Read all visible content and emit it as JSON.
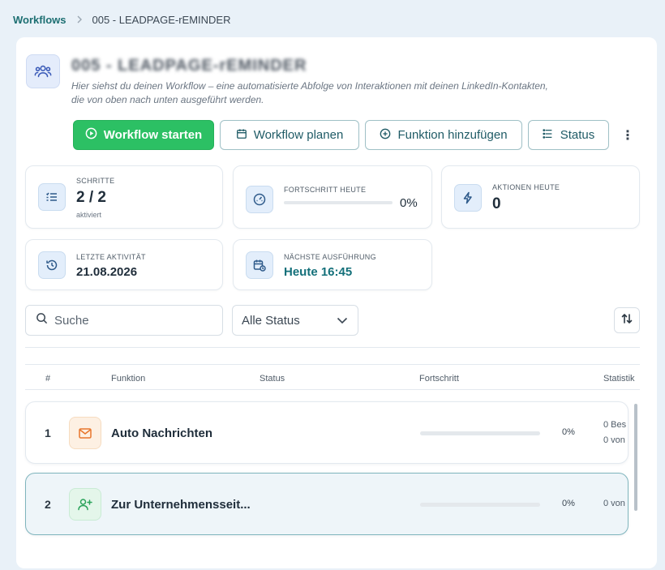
{
  "breadcrumb": {
    "root": "Workflows",
    "separator": ">",
    "current": "005 - LEADPAGE-rEMINDER"
  },
  "header": {
    "title_blurred": "005 - LEADPAGE-rEMINDER",
    "description": "Hier siehst du deinen Workflow – eine automatisierte Abfolge von Interaktionen mit deinen LinkedIn-Kontakten, die von oben nach unten ausgeführt werden."
  },
  "toolbar": {
    "start_label": "Workflow starten",
    "plan_label": "Workflow planen",
    "add_label": "Funktion hinzufügen",
    "status_label": "Status",
    "more_label": "⋮"
  },
  "stats": {
    "steps": {
      "label": "SCHRITTE",
      "value": "2 / 2",
      "sub": "aktiviert"
    },
    "progress_today": {
      "label": "FORTSCHRITT HEUTE",
      "value": "0%",
      "fraction": 0
    },
    "actions_today": {
      "label": "AKTIONEN HEUTE",
      "value": "0"
    },
    "last_activity": {
      "label": "LETZTE AKTIVITÄT",
      "value": "21.08.2026"
    },
    "next_run": {
      "label": "NÄCHSTE AUSFÜHRUNG",
      "value": "Heute 16:45"
    }
  },
  "filters": {
    "search_placeholder": "Suche",
    "status_selected": "Alle Status"
  },
  "table": {
    "headers": [
      "#",
      "Funktion",
      "Status",
      "Fortschritt",
      "Statistik"
    ],
    "rows": [
      {
        "num": "1",
        "name": "Auto Nachrichten",
        "icon": "mail-icon",
        "progress": "0%",
        "fraction": 0,
        "stat1": "0 Bes",
        "stat2": "0 von"
      },
      {
        "num": "2",
        "name": "Zur Unternehmensseit...",
        "icon": "user-plus-icon",
        "progress": "0%",
        "fraction": 0,
        "stat1": "0 von"
      }
    ]
  },
  "colors": {
    "accent_green": "#2cc064",
    "teal": "#14707a",
    "icon_blue_bg": "#e3eefb"
  }
}
